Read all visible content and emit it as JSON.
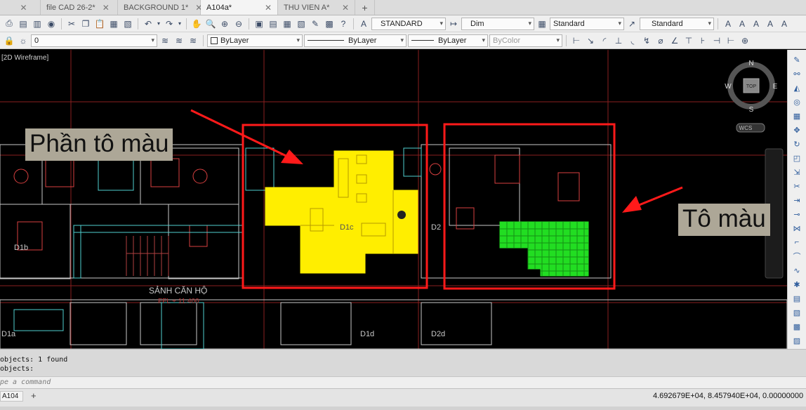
{
  "tabs": [
    {
      "label": "file CAD 26-2*"
    },
    {
      "label": "BACKGROUND 1*"
    },
    {
      "label": "A104a*"
    },
    {
      "label": "THU VIEN A*"
    }
  ],
  "toolbar1": {
    "text_style": "STANDARD",
    "dim_style": "Dim",
    "table_style": "Standard",
    "multileader_style": "Standard"
  },
  "toolbar2": {
    "layer": "0",
    "color": "ByLayer",
    "linetype": "ByLayer",
    "lineweight": "ByLayer",
    "plot_style": "ByColor"
  },
  "viewport": {
    "label": "[2D Wireframe]",
    "viewcube": {
      "top": "TOP",
      "north": "N",
      "south": "S",
      "east": "E",
      "west": "W",
      "ucs": "WCS"
    },
    "room_labels": [
      "D1b",
      "D1c",
      "D2",
      "D1a",
      "D1d",
      "D2d"
    ],
    "lobby_label": "SẢNH CĂN HỘ",
    "lobby_level": "FFL + 11.400"
  },
  "annotations": {
    "callout_left": "Phần tô màu",
    "callout_right": "Tô màu",
    "colors": {
      "highlight": "#ff1a1a",
      "yellow_fill": "#ffee00",
      "green_fill": "#22dd22",
      "label_bg": "#ada797"
    }
  },
  "command": {
    "history": [
      "objects: 1 found",
      "objects:"
    ],
    "prompt": "pe a command"
  },
  "status": {
    "layout_tab": "A104",
    "coordinates": "4.692679E+04, 8.457940E+04, 0.00000000"
  }
}
